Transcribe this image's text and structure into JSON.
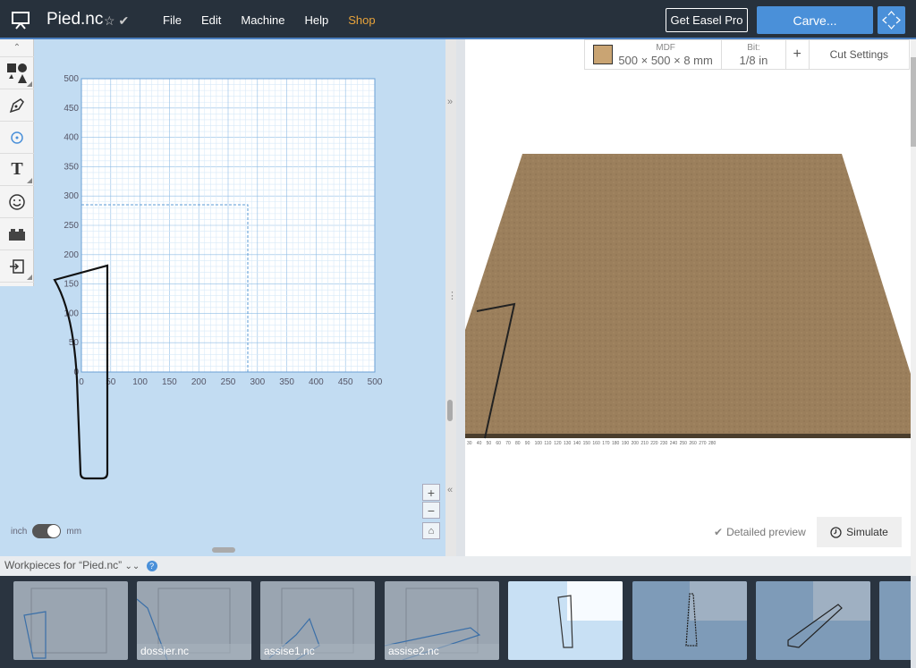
{
  "topbar": {
    "doc_title": "Pied.nc",
    "menu": [
      "File",
      "Edit",
      "Machine",
      "Help",
      "Shop"
    ],
    "pro_label": "Get Easel Pro",
    "carve_label": "Carve..."
  },
  "design": {
    "y_ticks": [
      "500",
      "450",
      "400",
      "350",
      "300",
      "250",
      "200",
      "150",
      "100",
      "50",
      "0"
    ],
    "x_ticks": [
      "0",
      "50",
      "100",
      "150",
      "200",
      "250",
      "300",
      "350",
      "400",
      "450",
      "500"
    ],
    "units_left": "inch",
    "units_right": "mm"
  },
  "material": {
    "name": "MDF",
    "size": "500 × 500 × 8 mm",
    "bit_label": "Bit:",
    "bit_value": "1/8 in",
    "cut_settings": "Cut Settings",
    "swatch_color": "#c9a473"
  },
  "preview": {
    "detailed_label": "Detailed preview",
    "simulate_label": "Simulate",
    "ruler_ticks": [
      "30",
      "40",
      "50",
      "60",
      "70",
      "80",
      "90",
      "100",
      "110",
      "120",
      "130",
      "140",
      "150",
      "160",
      "170",
      "180",
      "190",
      "200",
      "210",
      "220",
      "230",
      "240",
      "250",
      "260",
      "270",
      "280"
    ]
  },
  "workpieces": {
    "header": "Workpieces for “Pied.nc”",
    "items": [
      {
        "label": ""
      },
      {
        "label": "dossier.nc"
      },
      {
        "label": "assise1.nc"
      },
      {
        "label": "assise2.nc"
      },
      {
        "label": ""
      },
      {
        "label": ""
      },
      {
        "label": ""
      }
    ]
  }
}
